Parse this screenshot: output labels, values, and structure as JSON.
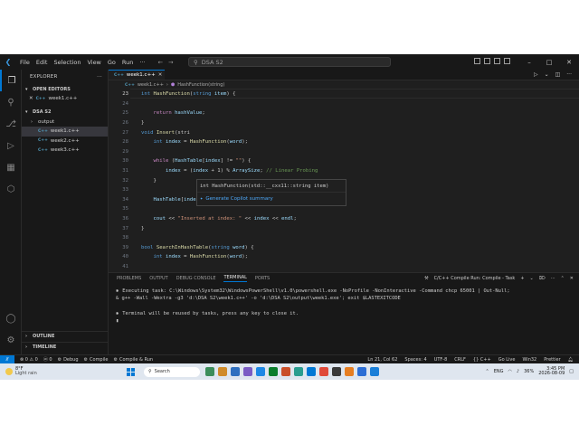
{
  "titlebar": {
    "menu": [
      "File",
      "Edit",
      "Selection",
      "View",
      "Go",
      "Run",
      "···"
    ],
    "search": "DSA S2",
    "window_controls": [
      "–",
      "□",
      "✕"
    ]
  },
  "sidebar": {
    "header": "EXPLORER",
    "header_more": "···",
    "open_editors_label": "OPEN EDITORS",
    "open_editors": [
      {
        "name": "week1.c++",
        "icon": "cpp-icon"
      }
    ],
    "folder_label": "DSA S2",
    "items": [
      {
        "name": "output",
        "type": "folder"
      },
      {
        "name": "week1.c++",
        "type": "file",
        "selected": true
      },
      {
        "name": "week2.c++",
        "type": "file"
      },
      {
        "name": "week3.c++",
        "type": "file"
      }
    ],
    "outline_label": "OUTLINE",
    "timeline_label": "TIMELINE"
  },
  "editor": {
    "tab_label": "week1.c++",
    "cpp_badge": "C++",
    "breadcrumb": [
      "week1.c++",
      "HashFunction(string)"
    ],
    "lines": [
      {
        "num": "23",
        "parts": [
          [
            "kw",
            "int "
          ],
          [
            "fn",
            "HashFunction"
          ],
          [
            "",
            "("
          ],
          [
            "kw",
            "string "
          ],
          [
            "var",
            "item"
          ],
          [
            "",
            ") {"
          ]
        ]
      },
      {
        "num": "24",
        "parts": []
      },
      {
        "num": "25",
        "parts": [
          [
            "",
            "    "
          ],
          [
            "ctl",
            "return "
          ],
          [
            "var",
            "hashValue"
          ],
          [
            "",
            ";"
          ]
        ]
      },
      {
        "num": "26",
        "parts": [
          [
            "",
            "}"
          ]
        ]
      },
      {
        "num": "27",
        "parts": [
          [
            "kw",
            "void "
          ],
          [
            "fn",
            "Insert"
          ],
          [
            "",
            "(stri"
          ]
        ]
      },
      {
        "num": "28",
        "parts": [
          [
            "",
            "    "
          ],
          [
            "kw",
            "int "
          ],
          [
            "var",
            "index"
          ],
          [
            "",
            " = "
          ],
          [
            "fn",
            "HashFunction"
          ],
          [
            "",
            "("
          ],
          [
            "var",
            "word"
          ],
          [
            "",
            ");"
          ]
        ]
      },
      {
        "num": "29",
        "parts": []
      },
      {
        "num": "30",
        "parts": [
          [
            "",
            "    "
          ],
          [
            "ctl",
            "while "
          ],
          [
            "",
            "("
          ],
          [
            "var",
            "HashTable"
          ],
          [
            "",
            "["
          ],
          [
            "var",
            "index"
          ],
          [
            "",
            "] != "
          ],
          [
            "str",
            "\"\""
          ],
          [
            "",
            ") {"
          ]
        ]
      },
      {
        "num": "31",
        "parts": [
          [
            "",
            "        "
          ],
          [
            "var",
            "index"
          ],
          [
            "",
            " = ("
          ],
          [
            "var",
            "index"
          ],
          [
            "",
            " + 1) % "
          ],
          [
            "var",
            "ArraySize"
          ],
          [
            "",
            "; "
          ],
          [
            "cm",
            "// Linear Probing"
          ]
        ]
      },
      {
        "num": "32",
        "parts": [
          [
            "",
            "    }"
          ]
        ]
      },
      {
        "num": "33",
        "parts": []
      },
      {
        "num": "34",
        "parts": [
          [
            "",
            "    "
          ],
          [
            "var",
            "HashTable"
          ],
          [
            "",
            "["
          ],
          [
            "var",
            "index"
          ],
          [
            "",
            "] = "
          ],
          [
            "var",
            "word"
          ],
          [
            "",
            ";"
          ]
        ]
      },
      {
        "num": "35",
        "parts": []
      },
      {
        "num": "36",
        "parts": [
          [
            "",
            "    "
          ],
          [
            "var",
            "cout"
          ],
          [
            "",
            " << "
          ],
          [
            "str",
            "\"Inserted at index: \""
          ],
          [
            "",
            " << "
          ],
          [
            "var",
            "index"
          ],
          [
            "",
            " << "
          ],
          [
            "var",
            "endl"
          ],
          [
            "",
            ";"
          ]
        ]
      },
      {
        "num": "37",
        "parts": [
          [
            "",
            "}"
          ]
        ]
      },
      {
        "num": "38",
        "parts": []
      },
      {
        "num": "39",
        "parts": [
          [
            "kw",
            "bool "
          ],
          [
            "fn",
            "SearchInHashTable"
          ],
          [
            "",
            "("
          ],
          [
            "kw",
            "string "
          ],
          [
            "var",
            "word"
          ],
          [
            "",
            ") {"
          ]
        ]
      },
      {
        "num": "40",
        "parts": [
          [
            "",
            "    "
          ],
          [
            "kw",
            "int "
          ],
          [
            "var",
            "index"
          ],
          [
            "",
            " = "
          ],
          [
            "fn",
            "HashFunction"
          ],
          [
            "",
            "("
          ],
          [
            "var",
            "word"
          ],
          [
            "",
            ");"
          ]
        ]
      },
      {
        "num": "41",
        "parts": []
      }
    ],
    "hover": {
      "signature": "int HashFunction(std::__cxx11::string item)",
      "action": "Generate Copilot summary"
    }
  },
  "panel": {
    "tabs": [
      "PROBLEMS",
      "OUTPUT",
      "DEBUG CONSOLE",
      "TERMINAL",
      "PORTS"
    ],
    "active_tab": "TERMINAL",
    "terminal_name": "C/C++ Compile Run: Compile - Task",
    "terminal_lines": [
      "Executing task: C:\\Windows\\System32\\WindowsPowerShell\\v1.0\\powershell.exe -NoProfile -NonInteractive -Command chcp 65001 | Out-Null;",
      "& g++ -Wall -Wextra -g3 'd:\\DSA S2\\week1.c++' -o 'd:\\DSA S2\\output\\week1.exe'; exit $LASTEXITCODE",
      "Terminal will be reused by tasks, press any key to close it."
    ]
  },
  "status": {
    "left": [
      "⊗ 0 ⚠ 0",
      "ⓦ 0",
      "Debug",
      "Compile",
      "Compile & Run"
    ],
    "right": [
      "Ln 21, Col 62",
      "Spaces: 4",
      "UTF-8",
      "CRLF",
      "{} C++",
      "Go Live",
      "Win32",
      "Prettier"
    ]
  },
  "taskbar": {
    "temperature": "8°F",
    "weather": "Light rain",
    "search": "Search",
    "lang": "ENG",
    "battery": "36%",
    "time": "3:45 PM",
    "date": "2026-08-09",
    "app_colors": [
      "#3c8d5a",
      "#d08b2a",
      "#2f6fbf",
      "#7b5cc4",
      "#1e88e5",
      "#0a7d2c",
      "#c94f2a",
      "#2a9d8f",
      "#0078d4",
      "#e04a3a",
      "#3a3a3a",
      "#e67e22",
      "#2c6ed5",
      "#1a7fd8"
    ]
  }
}
